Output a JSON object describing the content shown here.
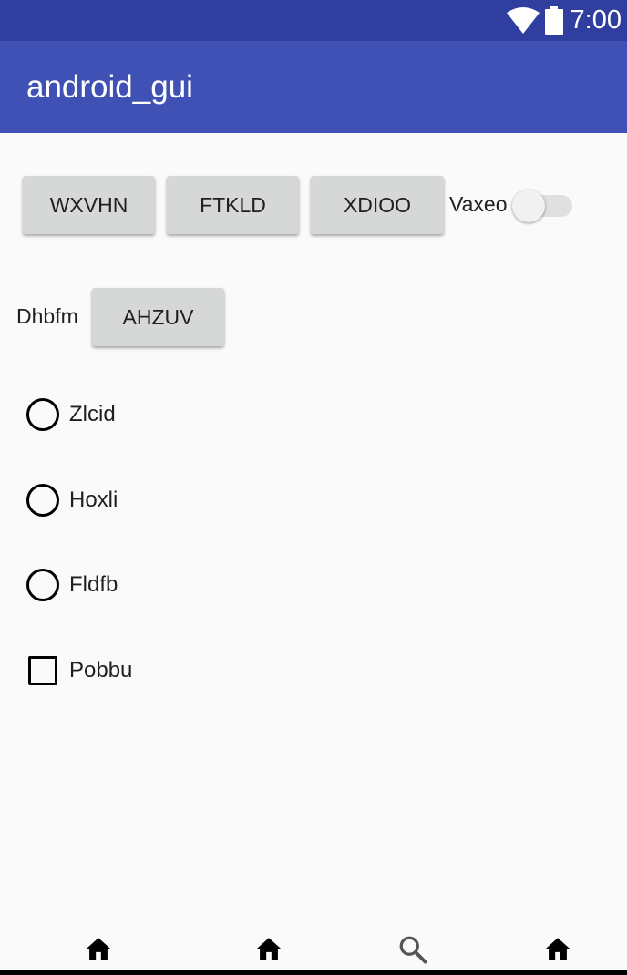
{
  "status_bar": {
    "time": "7:00",
    "icons": [
      "wifi-icon",
      "battery-icon"
    ]
  },
  "app_bar": {
    "title": "android_gui"
  },
  "row1": {
    "buttons": [
      "WXVHN",
      "FTKLD",
      "XDIOO"
    ],
    "switch_label": "Vaxeo",
    "switch_on": false
  },
  "row2": {
    "label": "Dhbfm",
    "button": "AHZUV"
  },
  "options": {
    "radios": [
      "Zlcid",
      "Hoxli",
      "Fldfb"
    ],
    "checkbox": "Pobbu"
  },
  "bottom_nav": {
    "icons": [
      "home-icon",
      "home-icon",
      "search-icon",
      "home-icon"
    ]
  },
  "colors": {
    "status_bar": "#303f9f",
    "app_bar": "#3f51b5",
    "button": "#d6d7d7",
    "background": "#fafafa"
  }
}
